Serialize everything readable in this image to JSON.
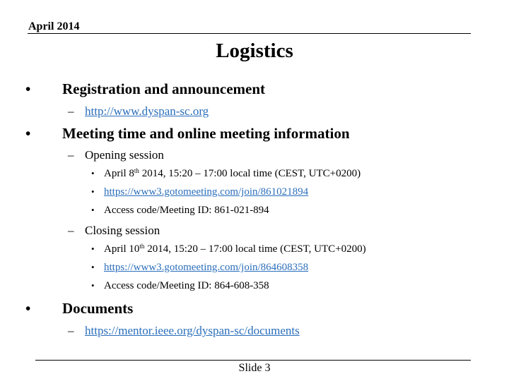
{
  "header": {
    "date": "April 2014"
  },
  "title": "Logistics",
  "sections": [
    {
      "label": "Registration and announcement",
      "items": [
        {
          "text": "http://www.dyspan-sc.org",
          "link": true
        }
      ]
    },
    {
      "label": "Meeting time and online meeting information",
      "sessions": [
        {
          "label": "Opening session",
          "date_prefix": "April 8",
          "date_sup": "th",
          "date_suffix": " 2014, 15:20 – 17:00 local time (CEST, UTC+0200)",
          "link": "https://www3.gotomeeting.com/join/861021894",
          "access": "Access code/Meeting ID: 861-021-894"
        },
        {
          "label": "Closing session",
          "date_prefix": "April 10",
          "date_sup": "th",
          "date_suffix": " 2014, 15:20 – 17:00 local time (CEST, UTC+0200)",
          "link": "https://www3.gotomeeting.com/join/864608358",
          "access": "Access code/Meeting ID: 864-608-358"
        }
      ]
    },
    {
      "label": "Documents",
      "items": [
        {
          "text": "https://mentor.ieee.org/dyspan-sc/documents",
          "link": true
        }
      ]
    }
  ],
  "footer": {
    "slide": "Slide 3"
  },
  "glyphs": {
    "bullet": "•",
    "dash": "–"
  },
  "colors": {
    "link": "#2a6ebb",
    "text": "#000000"
  }
}
